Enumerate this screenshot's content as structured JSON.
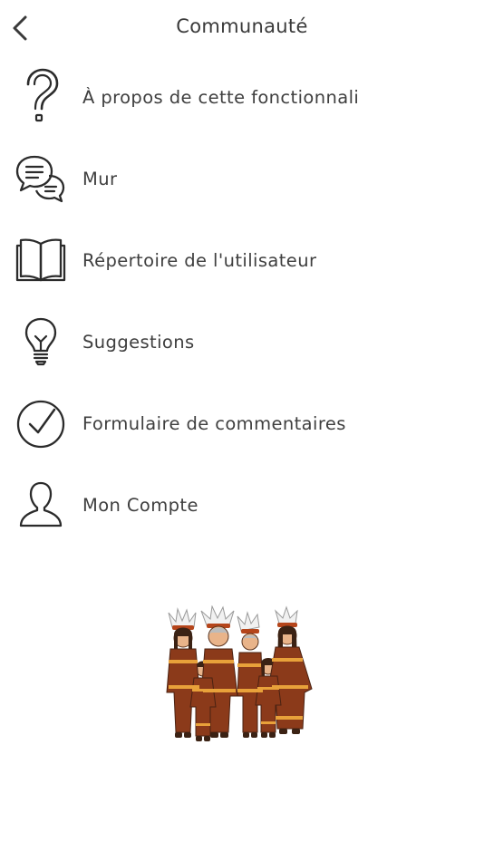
{
  "header": {
    "title": "Communauté",
    "back_icon": "chevron-left-icon"
  },
  "menu": {
    "items": [
      {
        "label": "À propos de cette fonctionnali",
        "icon": "question-mark-icon"
      },
      {
        "label": "Mur",
        "icon": "chat-bubbles-icon"
      },
      {
        "label": "Répertoire de l'utilisateur",
        "icon": "open-book-icon"
      },
      {
        "label": "Suggestions",
        "icon": "lightbulb-icon"
      },
      {
        "label": "Formulaire de commentaires",
        "icon": "check-circle-icon"
      },
      {
        "label": "Mon Compte",
        "icon": "user-icon"
      }
    ]
  },
  "illustration": {
    "subject": "family-in-traditional-native-dress",
    "colors": {
      "primary": "#8b3a1a",
      "accent": "#e8a13a",
      "dark": "#3b2214"
    }
  }
}
